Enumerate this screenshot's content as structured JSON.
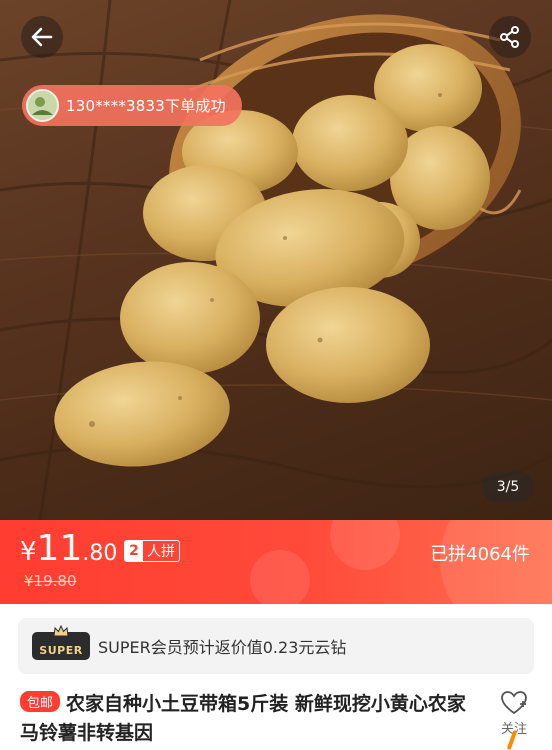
{
  "nav": {
    "back_icon": "arrow-left-icon",
    "share_icon": "share-icon"
  },
  "toast": {
    "text": "130****3833下单成功"
  },
  "gallery": {
    "counter": "3/5"
  },
  "price": {
    "currency": "¥",
    "integer": "11",
    "decimal": ".80",
    "group_num": "2",
    "group_label": "人拼",
    "original": "¥19.80",
    "sold": "已拼4064件"
  },
  "member": {
    "badge": "SUPER",
    "text": "SUPER会员预计返价值0.23元云钻"
  },
  "product": {
    "tag": "包邮",
    "title": "农家自种小土豆带箱5斤装 新鲜现挖小黄心农家马铃薯非转基因"
  },
  "follow": {
    "label": "关注"
  },
  "colors": {
    "accent": "#ff3d30",
    "toast": "#f4725e",
    "member_gold": "#f1d08a"
  }
}
